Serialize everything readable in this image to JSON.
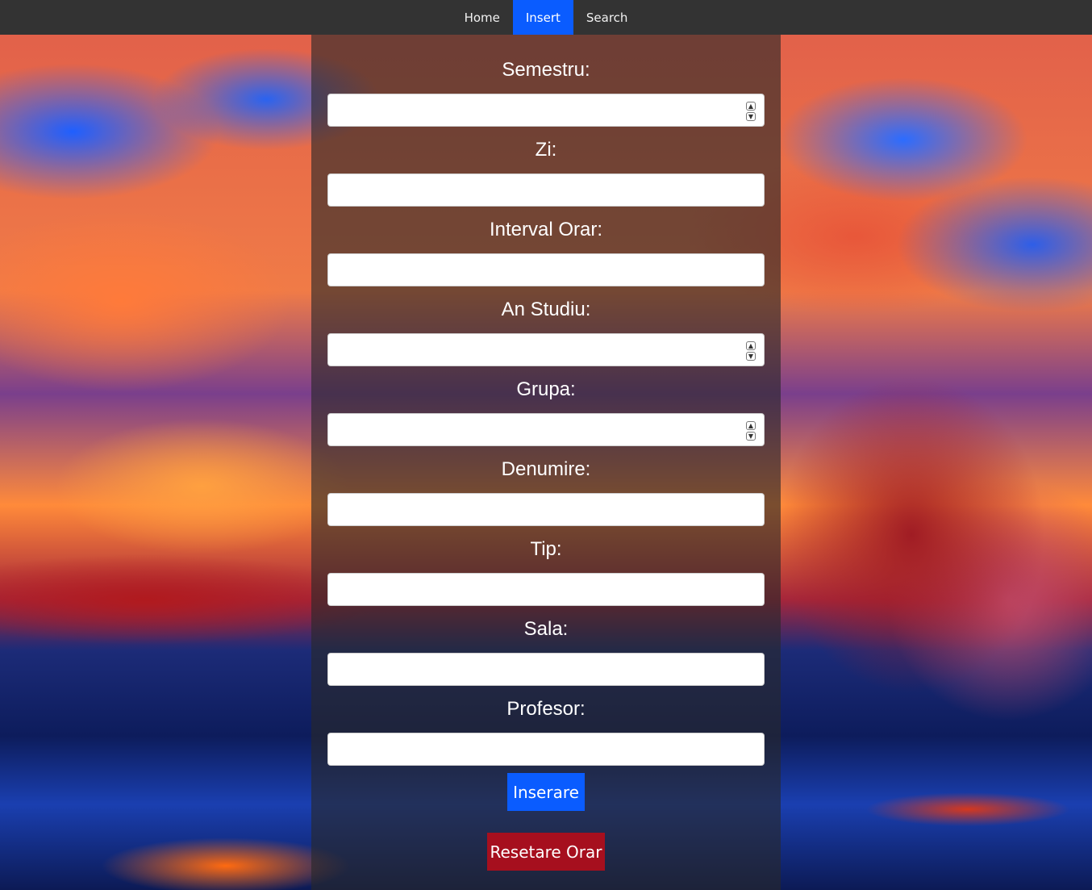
{
  "nav": {
    "items": [
      {
        "label": "Home",
        "active": false
      },
      {
        "label": "Insert",
        "active": true
      },
      {
        "label": "Search",
        "active": false
      }
    ]
  },
  "form": {
    "fields": [
      {
        "label": "Semestru:",
        "type": "number",
        "value": ""
      },
      {
        "label": "Zi:",
        "type": "text",
        "value": ""
      },
      {
        "label": "Interval Orar:",
        "type": "text",
        "value": ""
      },
      {
        "label": "An Studiu:",
        "type": "number",
        "value": ""
      },
      {
        "label": "Grupa:",
        "type": "number",
        "value": ""
      },
      {
        "label": "Denumire:",
        "type": "text",
        "value": ""
      },
      {
        "label": "Tip:",
        "type": "text",
        "value": ""
      },
      {
        "label": "Sala:",
        "type": "text",
        "value": ""
      },
      {
        "label": "Profesor:",
        "type": "text",
        "value": ""
      }
    ],
    "submit_label": "Inserare",
    "reset_label": "Resetare Orar"
  },
  "colors": {
    "nav_bg": "#333333",
    "nav_active": "#0a5cff",
    "submit_button": "#0a5cff",
    "reset_button": "#a60f1e"
  }
}
